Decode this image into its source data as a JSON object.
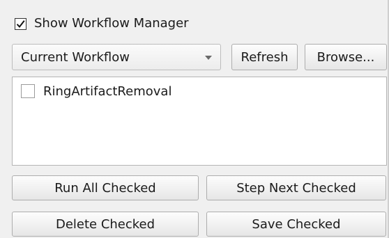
{
  "workflow_manager": {
    "show_label": "Show Workflow Manager",
    "show_checked": true,
    "combo_value": "Current Workflow",
    "refresh_label": "Refresh",
    "browse_label": "Browse...",
    "items": [
      {
        "label": "RingArtifactRemoval",
        "checked": false
      }
    ],
    "run_all_label": "Run All Checked",
    "step_next_label": "Step Next Checked",
    "delete_label": "Delete Checked",
    "save_label": "Save Checked"
  },
  "icons": {
    "show_check": "checkmark-icon",
    "combo_arrow": "chevron-down-icon"
  }
}
